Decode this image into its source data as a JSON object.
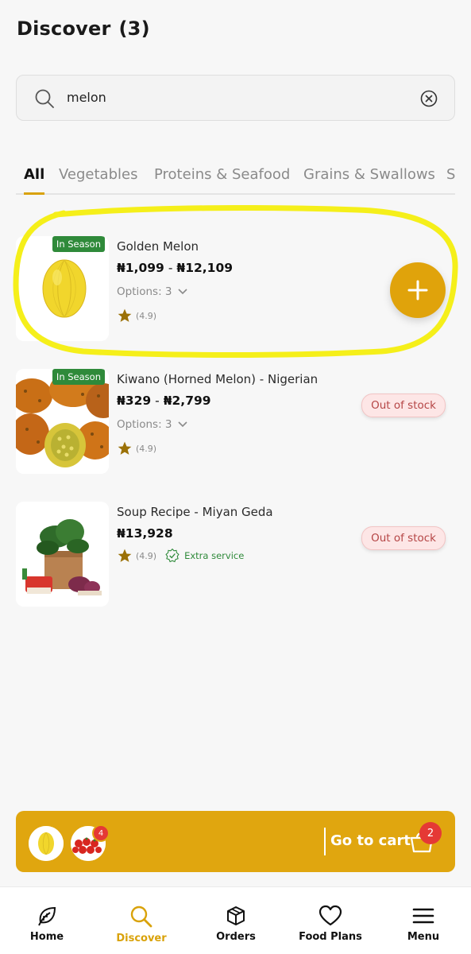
{
  "header": {
    "title": "Discover",
    "count": "(3)"
  },
  "search": {
    "value": "melon"
  },
  "tabs": [
    {
      "label": "All",
      "active": true
    },
    {
      "label": "Vegetables"
    },
    {
      "label": "Proteins & Seafood"
    },
    {
      "label": "Grains & Swallows"
    },
    {
      "label": "S"
    }
  ],
  "products": [
    {
      "badge": "In Season",
      "name": "Golden Melon",
      "price_min": "₦1,099",
      "price_sep": "-",
      "price_max": "₦12,109",
      "options": "Options: 3",
      "rating": "(4.9)",
      "action": "add"
    },
    {
      "badge": "In Season",
      "name": "Kiwano (Horned Melon) - Nigerian",
      "price_min": "₦329",
      "price_sep": "-",
      "price_max": "₦2,799",
      "options": "Options: 3",
      "rating": "(4.9)",
      "stock": "Out of stock"
    },
    {
      "name": "Soup Recipe - Miyan Geda",
      "price": "₦13,928",
      "rating": "(4.9)",
      "extra": "Extra service",
      "stock": "Out of stock"
    }
  ],
  "cart": {
    "item_qty": "4",
    "label": "Go to cart",
    "count": "2"
  },
  "nav": [
    {
      "label": "Home",
      "icon": "leaf-icon"
    },
    {
      "label": "Discover",
      "icon": "search-icon",
      "active": true
    },
    {
      "label": "Orders",
      "icon": "box-icon"
    },
    {
      "label": "Food Plans",
      "icon": "heart-icon"
    },
    {
      "label": "Menu",
      "icon": "menu-icon"
    }
  ],
  "colors": {
    "accent": "#e0a60f",
    "badge": "#2f8a3a",
    "out_of_stock": "#b54545",
    "highlight": "#f5ef1a"
  }
}
